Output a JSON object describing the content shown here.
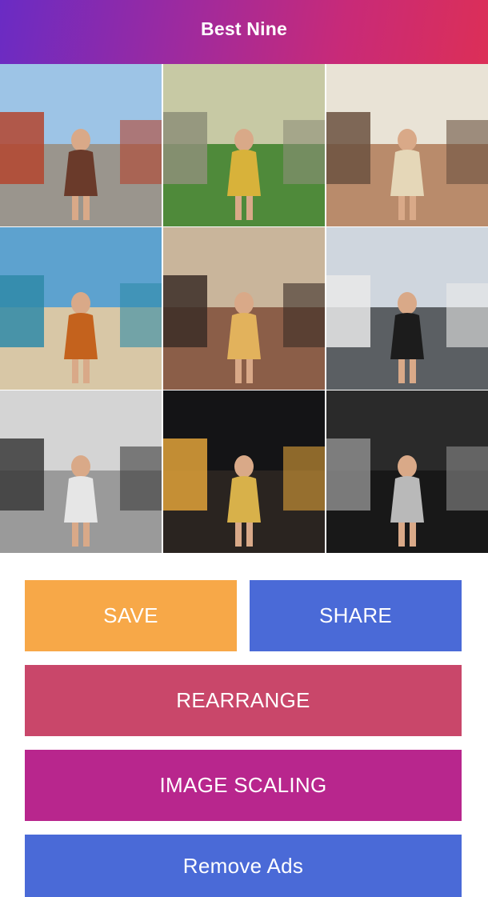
{
  "header": {
    "title": "Best Nine"
  },
  "grid": {
    "tiles": [
      {
        "label": "street-photo",
        "sky": "#9dc4e6",
        "ground": "#9a958d",
        "accent": "#b4452e",
        "figure": "#6a3a2a"
      },
      {
        "label": "house-porch-photo",
        "sky": "#c7c9a4",
        "ground": "#4f8a3a",
        "accent": "#8d8f79",
        "figure": "#d8b23a"
      },
      {
        "label": "diner-counter-photo",
        "sky": "#e9e3d6",
        "ground": "#b98b6b",
        "accent": "#6b5140",
        "figure": "#e5d7b8"
      },
      {
        "label": "beach-photo",
        "sky": "#5da2cf",
        "ground": "#d8c7a6",
        "accent": "#2f8aa8",
        "figure": "#c4621d"
      },
      {
        "label": "balcony-photo",
        "sky": "#c9b59b",
        "ground": "#8b5e48",
        "accent": "#3b2d27",
        "figure": "#e2b25c"
      },
      {
        "label": "crosswalk-photo",
        "sky": "#cfd6de",
        "ground": "#5b5f63",
        "accent": "#e9e9e9",
        "figure": "#1c1c1c"
      },
      {
        "label": "diner-bw-photo",
        "sky": "#d4d4d4",
        "ground": "#9a9a9a",
        "accent": "#3a3a3a",
        "figure": "#e6e6e6"
      },
      {
        "label": "stage-performance-photo",
        "sky": "#141416",
        "ground": "#2a2420",
        "accent": "#e0a23a",
        "figure": "#d8b14a"
      },
      {
        "label": "bar-bw-photo",
        "sky": "#2a2a2a",
        "ground": "#181818",
        "accent": "#8c8c8c",
        "figure": "#b9b9b9"
      }
    ]
  },
  "buttons": {
    "save": "SAVE",
    "share": "SHARE",
    "rearrange": "REARRANGE",
    "image_scaling": "IMAGE SCALING",
    "remove_ads": "Remove Ads"
  }
}
